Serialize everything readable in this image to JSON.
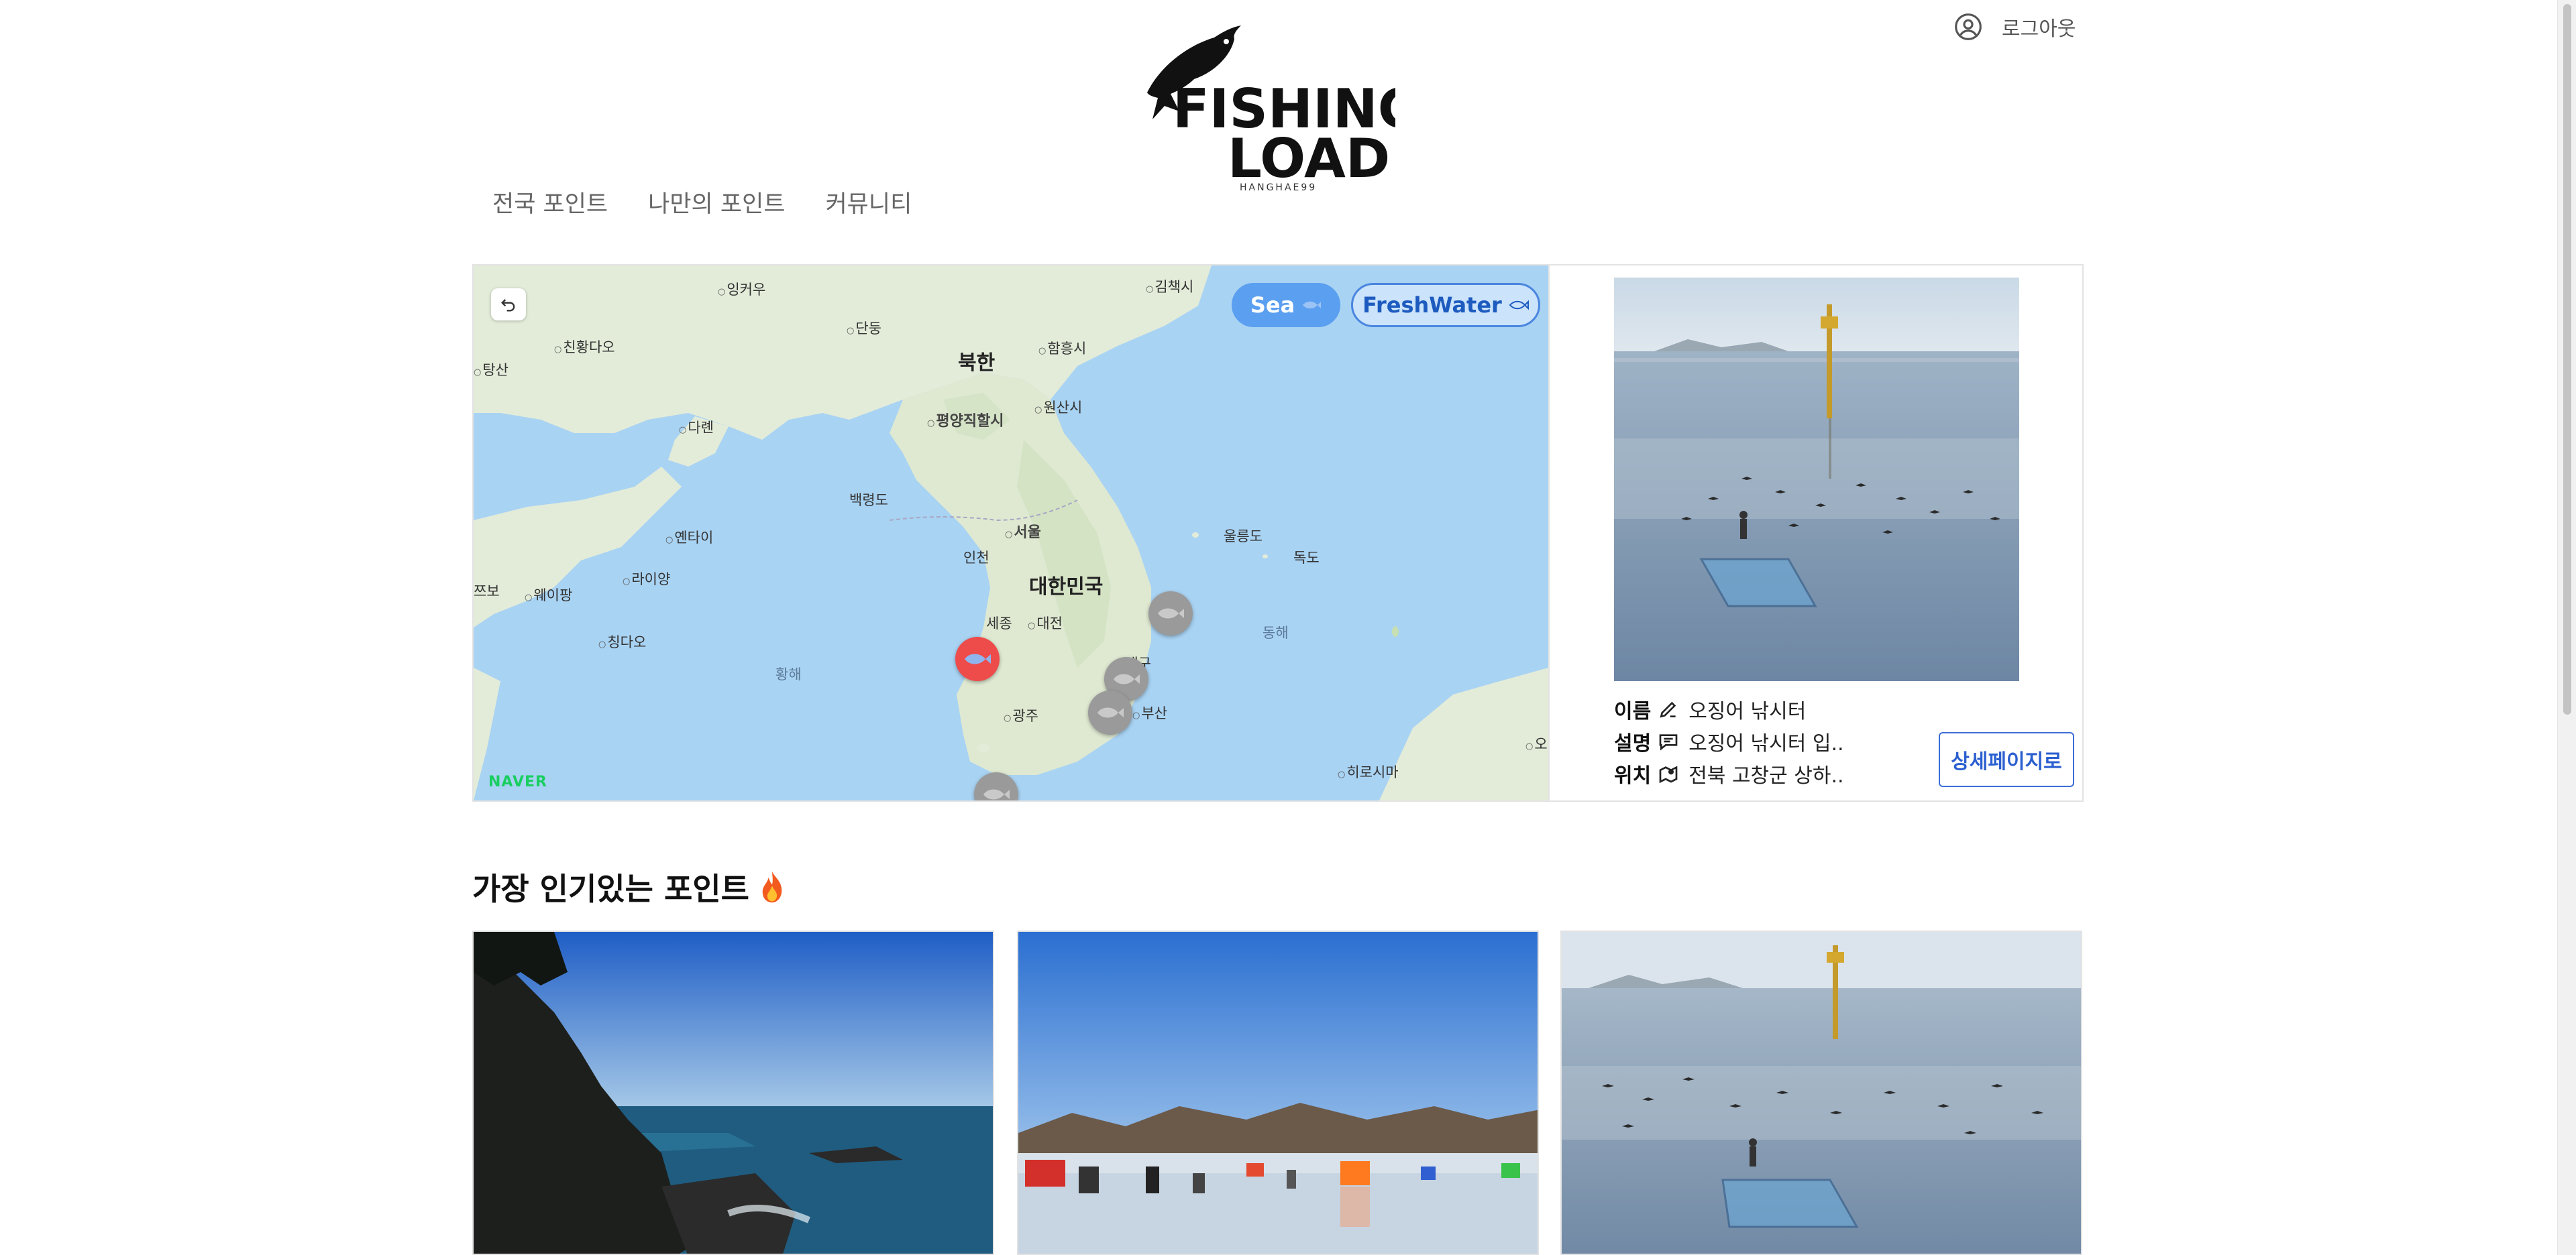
{
  "header": {
    "logout_label": "로그아웃",
    "logo": {
      "line1": "FISHING",
      "line2": "LOAD",
      "subtitle": "HANGHAE99"
    }
  },
  "nav": {
    "items": [
      {
        "label": "전국 포인트"
      },
      {
        "label": "나만의 포인트"
      },
      {
        "label": "커뮤니티"
      }
    ]
  },
  "map": {
    "toggle_sea": "Sea",
    "toggle_freshwater": "FreshWater",
    "provider_logo": "NAVER",
    "places": {
      "imgangu": "잉커우",
      "dandong": "단둥",
      "jilchaek": "김책시",
      "qinhuangdao": "친황다오",
      "hamheung": "함흥시",
      "north_korea": "북한",
      "tangshan": "탕산",
      "pyongyang": "평양직할시",
      "wonsan": "원산시",
      "dalian": "다롄",
      "baengnyeong": "백령도",
      "yantai": "옌타이",
      "seoul": "서울",
      "ulleung": "울릉도",
      "incheon": "인천",
      "dokdo": "독도",
      "laiyang": "라이양",
      "south_korea": "대한민국",
      "zibo": "쯔보",
      "weifang": "웨이팡",
      "sejong": "세종",
      "daejeon": "대전",
      "east_sea": "동해",
      "qingdao": "칭다오",
      "daegu": "대구",
      "yellow_sea": "황해",
      "gwangju": "광주",
      "busan": "부산",
      "hiroshima": "히로시마",
      "o": "오"
    }
  },
  "detail": {
    "name_label": "이름",
    "name_value": "오징어 낚시터",
    "desc_label": "설명",
    "desc_value": "오징어 낚시터 입..",
    "loc_label": "위치",
    "loc_value": "전북 고창군 상하..",
    "button_label": "상세페이지로"
  },
  "popular": {
    "title": "가장 인기있는 포인트"
  },
  "colors": {
    "sea_toggle": "#5b9ff0",
    "freshwater_border": "#4a86df",
    "marker_active": "#ee4b4b",
    "marker_inactive": "#9a9a9a",
    "naver_green": "#19ce60",
    "button_blue": "#2a5fcf"
  }
}
